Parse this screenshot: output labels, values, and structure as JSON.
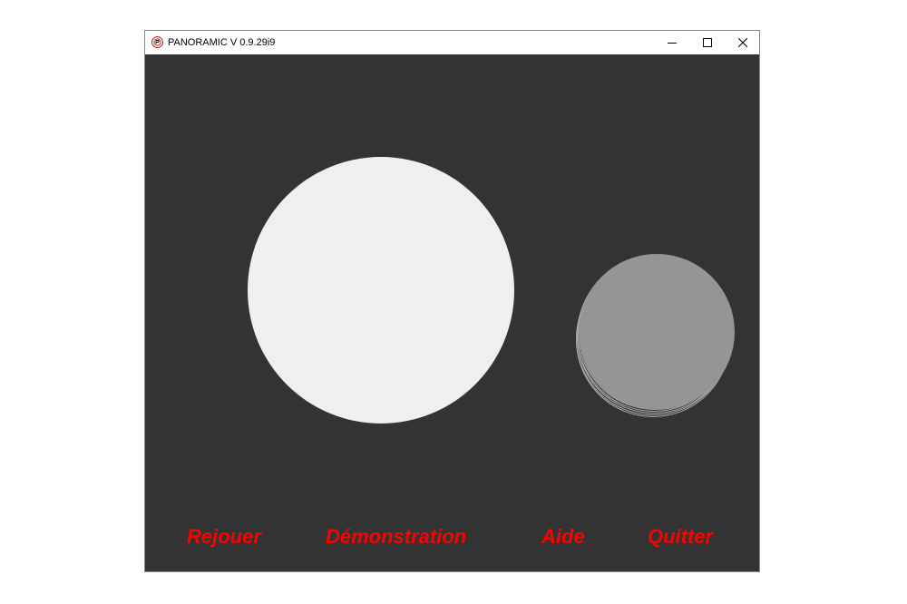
{
  "window": {
    "title": "PANORAMIC V 0.9.29i9",
    "app_icon": "panoramic-logo-icon",
    "controls": {
      "minimize_icon": "minimize-icon",
      "maximize_icon": "maximize-icon",
      "close_icon": "close-icon"
    }
  },
  "canvas": {
    "background_color": "#333333",
    "large_circle_color": "#efefef",
    "small_circle_color": "#959595",
    "small_circle_shadow_color": "#a9a9a9"
  },
  "menu": {
    "color": "#ff0000",
    "items": [
      {
        "label": "Rejouer"
      },
      {
        "label": "Démonstration"
      },
      {
        "label": "Aide"
      },
      {
        "label": "Quitter"
      }
    ]
  }
}
